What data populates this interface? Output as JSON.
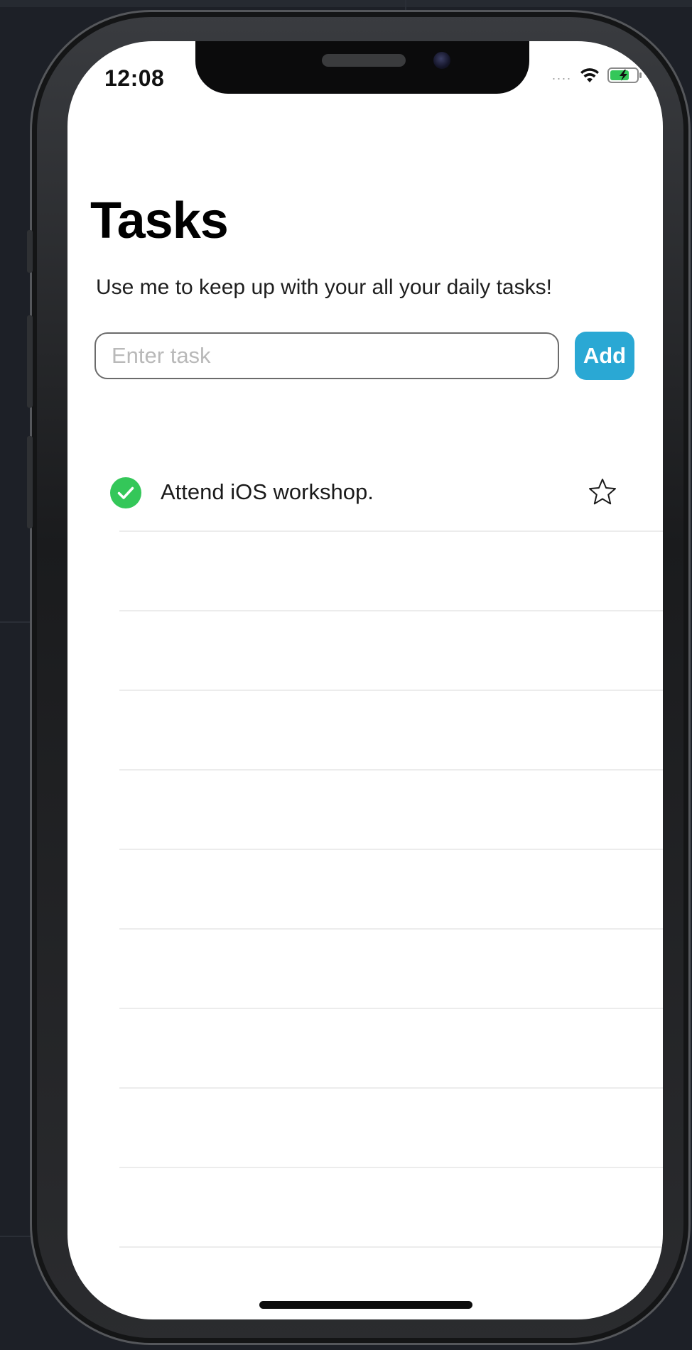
{
  "status_bar": {
    "time": "12:08",
    "signal": "....",
    "wifi_icon": "wifi-icon",
    "battery_icon": "battery-charging-icon"
  },
  "header": {
    "title": "Tasks",
    "subtitle": "Use me to keep up with your all your daily tasks!"
  },
  "task_input": {
    "value": "",
    "placeholder": "Enter task"
  },
  "add_button": {
    "label": "Add",
    "color": "#2aa8d4"
  },
  "tasks": [
    {
      "text": "Attend iOS workshop.",
      "completed": true,
      "starred": false
    }
  ],
  "empty_rows": 9,
  "colors": {
    "check": "#34c759",
    "divider": "#ececec",
    "background": "#ffffff"
  }
}
